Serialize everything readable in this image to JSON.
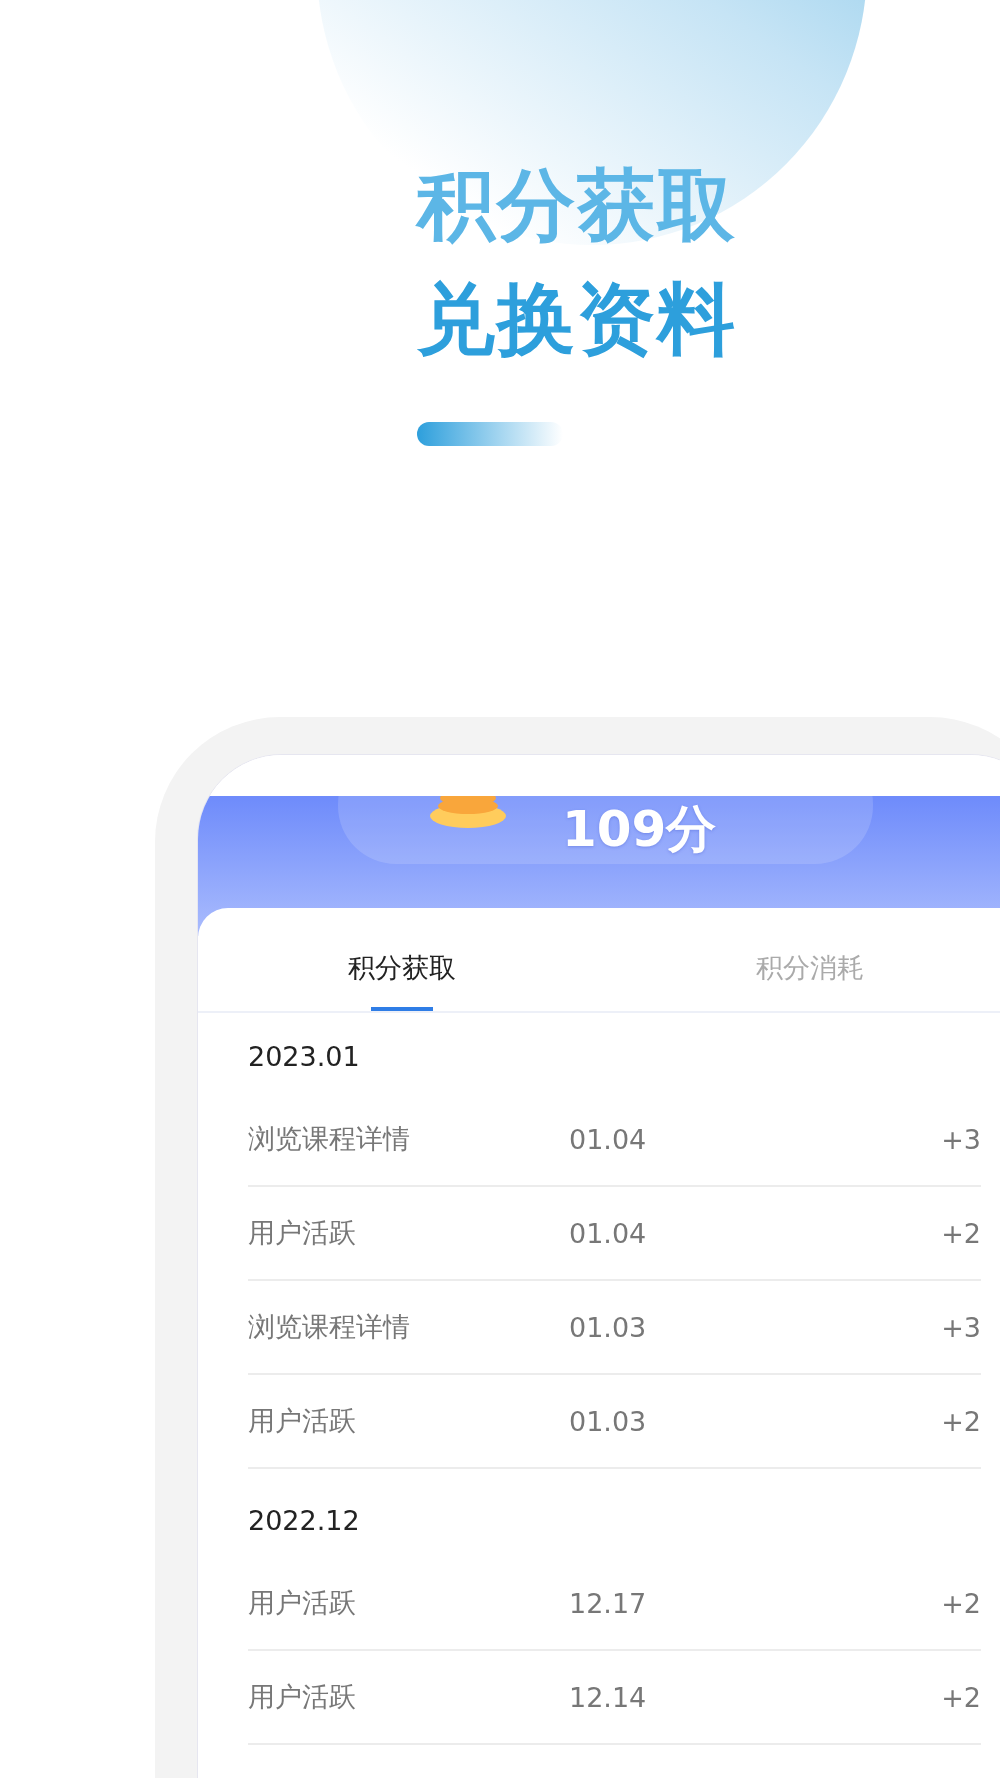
{
  "hero": {
    "title_lines": [
      "积分获取",
      "兑换资料"
    ]
  },
  "points": {
    "value": "109分"
  },
  "tabs": [
    {
      "label": "积分获取",
      "selected": true
    },
    {
      "label": "积分消耗",
      "selected": false
    }
  ],
  "groups": [
    {
      "month": "2023.01",
      "records": [
        {
          "action": "浏览课程详情",
          "date": "01.04",
          "points": "+3"
        },
        {
          "action": "用户活跃",
          "date": "01.04",
          "points": "+2"
        },
        {
          "action": "浏览课程详情",
          "date": "01.03",
          "points": "+3"
        },
        {
          "action": "用户活跃",
          "date": "01.03",
          "points": "+2"
        }
      ]
    },
    {
      "month": "2022.12",
      "records": [
        {
          "action": "用户活跃",
          "date": "12.17",
          "points": "+2"
        },
        {
          "action": "用户活跃",
          "date": "12.14",
          "points": "+2"
        }
      ]
    }
  ]
}
